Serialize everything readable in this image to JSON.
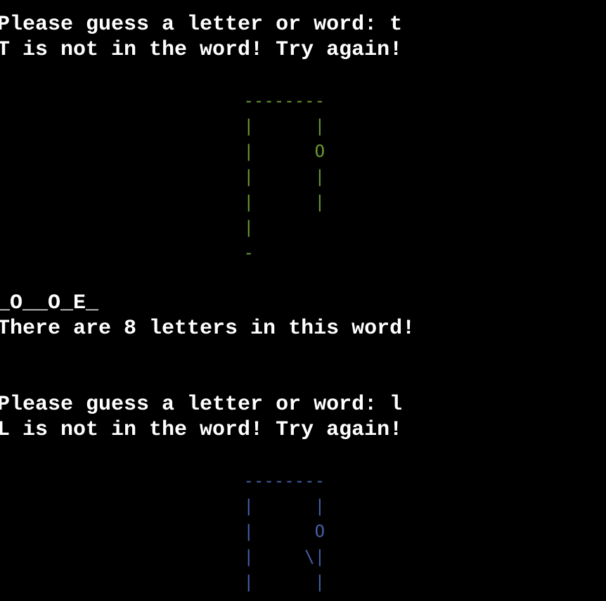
{
  "theme": {
    "background": "#000000",
    "text_color": "#ffffff",
    "gallows_color_1": "#6e9c35",
    "gallows_color_2": "#4561a8"
  },
  "terminal": {
    "lines": [
      "Please guess a letter or word: t",
      "T is not in the word! Try again!",
      "_O__O_E_",
      "There are 8 letters in this word!",
      "Please guess a letter or word: l",
      "L is not in the word! Try again!"
    ],
    "hangman_1": " --------\n |      |\n |      O\n |      |\n |      |\n |\n -",
    "hangman_2": " --------\n |      |\n |      O\n |     \\|\n |      |"
  }
}
